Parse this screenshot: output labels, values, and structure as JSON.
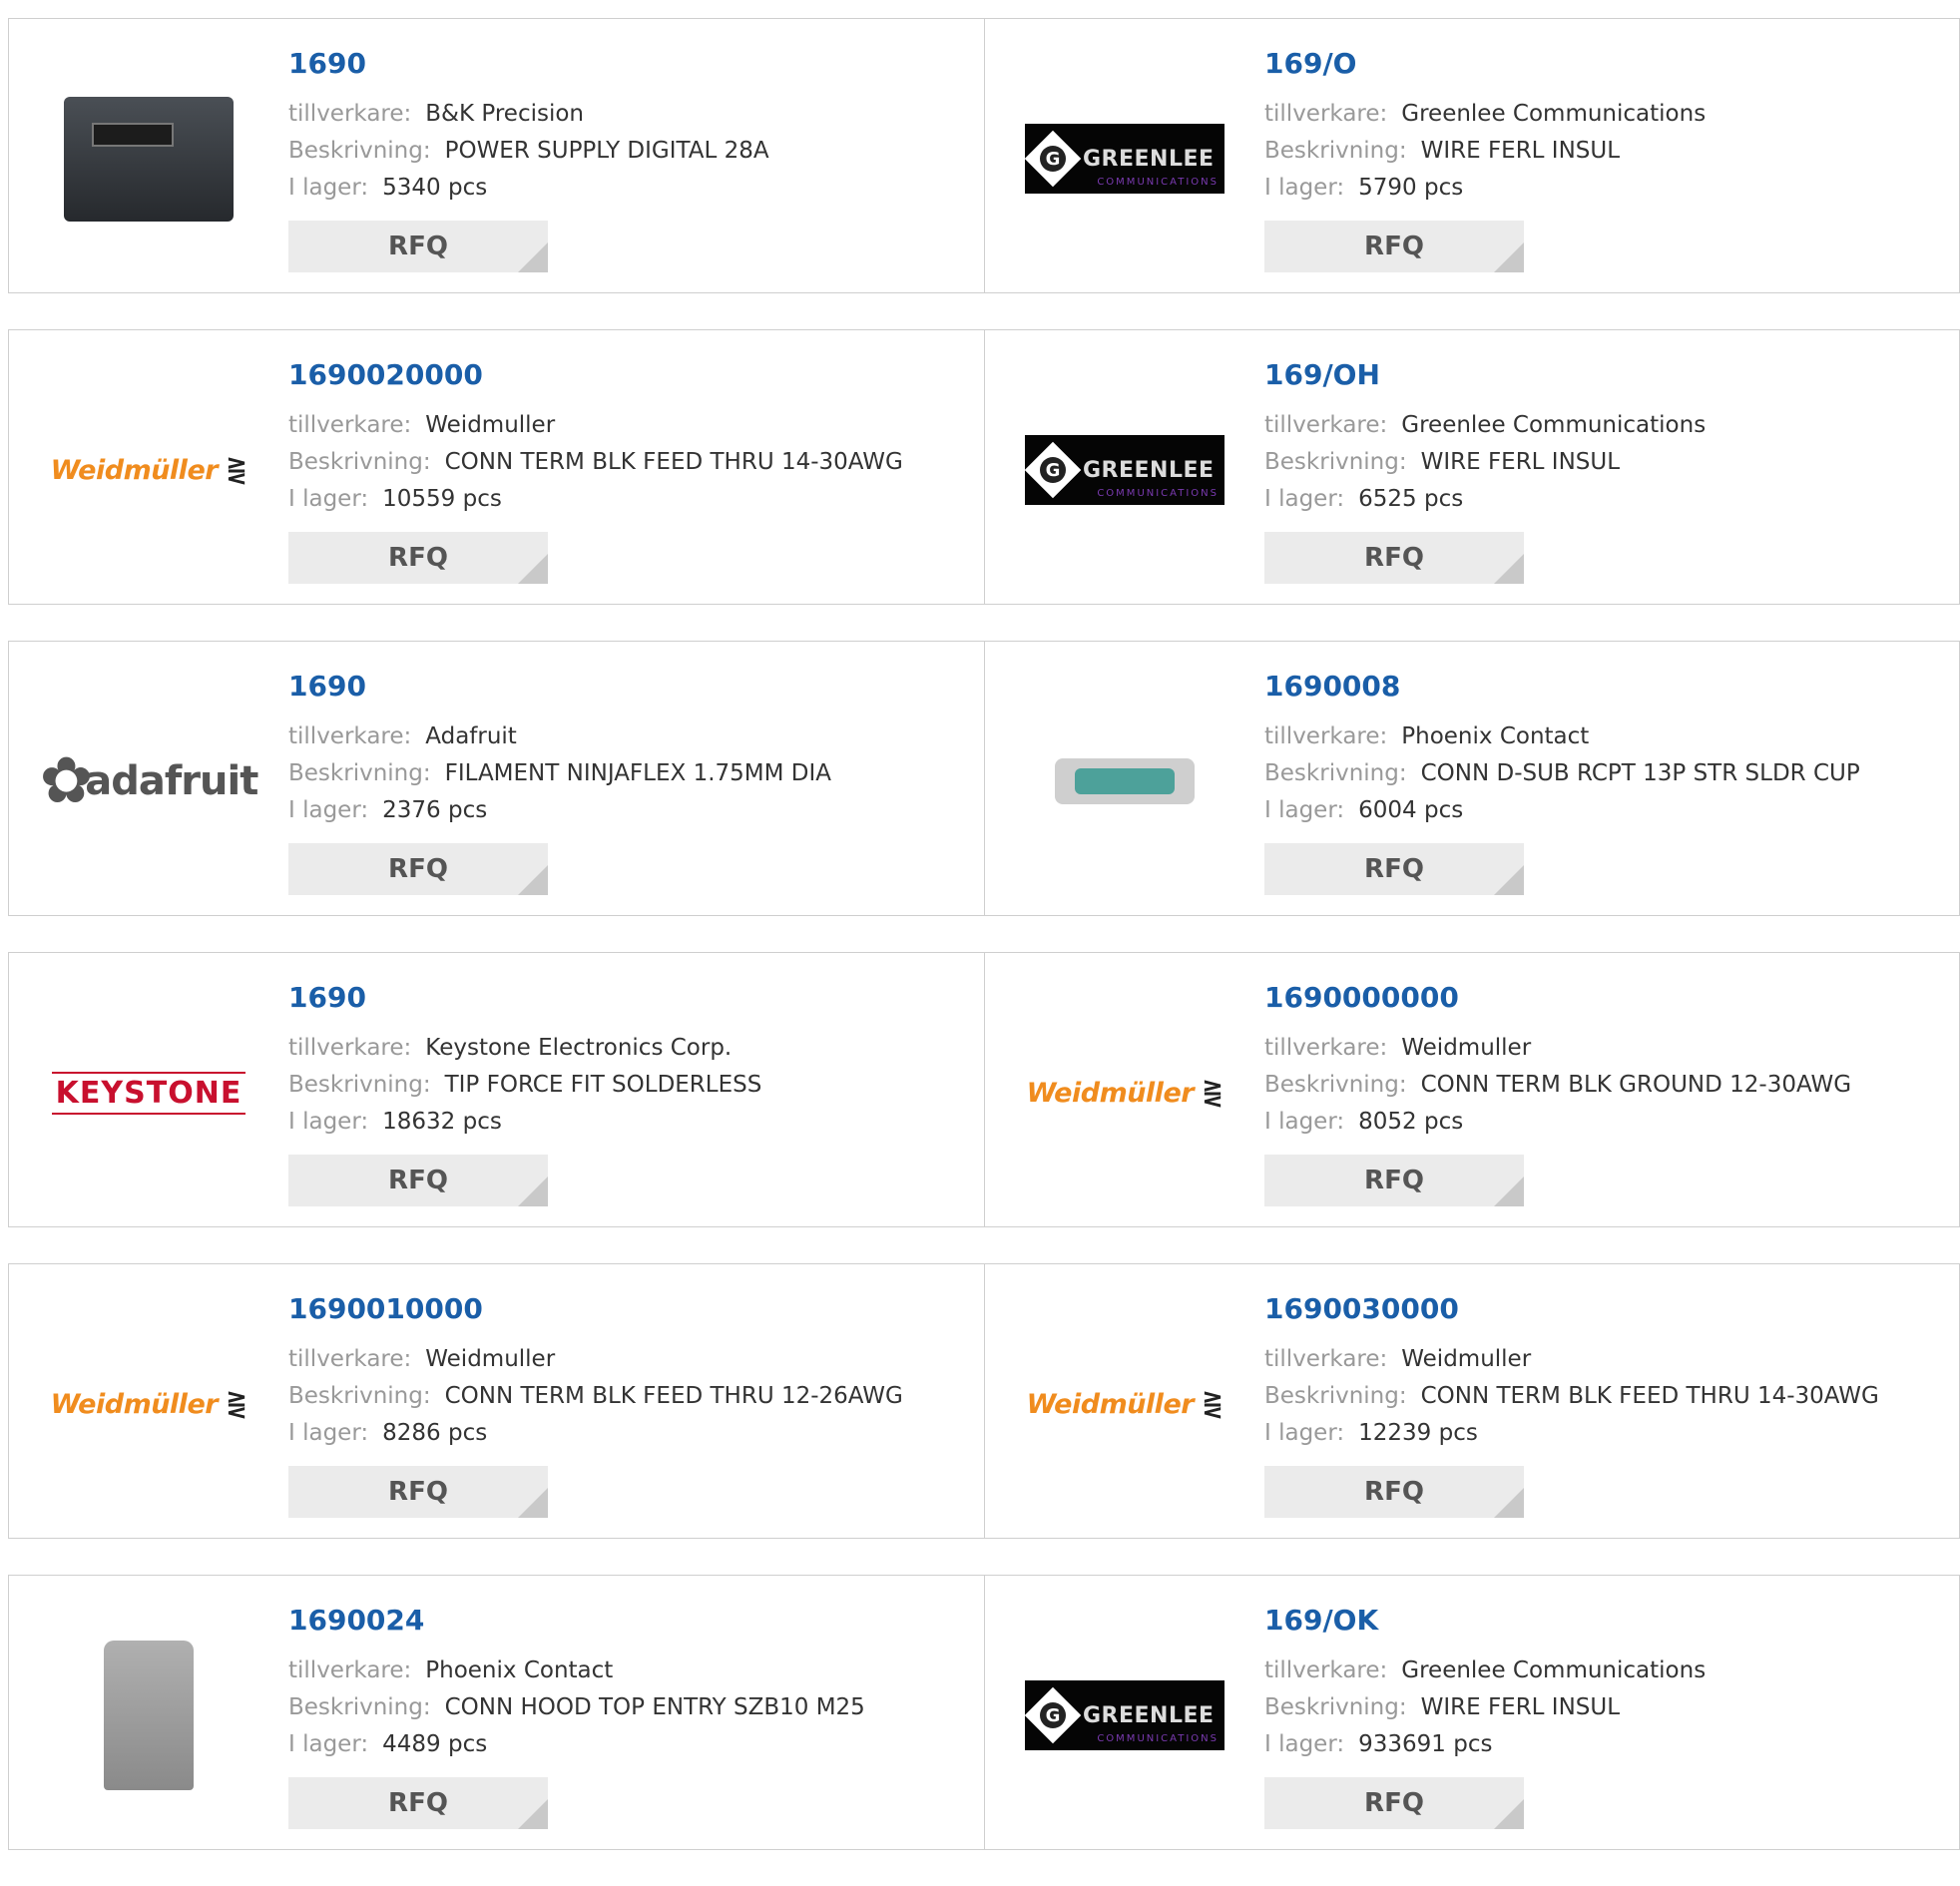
{
  "labels": {
    "manufacturer": "tillverkare:",
    "description": "Beskrivning:",
    "stock": "I lager:",
    "rfq": "RFQ"
  },
  "rows": [
    [
      {
        "part": "1690",
        "manufacturer": "B&K Precision",
        "description": "POWER SUPPLY DIGITAL 28A",
        "stock": "5340 pcs",
        "image": "power-supply-photo"
      },
      {
        "part": "169/O",
        "manufacturer": "Greenlee Communications",
        "description": "WIRE FERL INSUL",
        "stock": "5790 pcs",
        "image": "greenlee-logo"
      }
    ],
    [
      {
        "part": "1690020000",
        "manufacturer": "Weidmuller",
        "description": "CONN TERM BLK FEED THRU 14-30AWG",
        "stock": "10559 pcs",
        "image": "weidmuller-logo"
      },
      {
        "part": "169/OH",
        "manufacturer": "Greenlee Communications",
        "description": "WIRE FERL INSUL",
        "stock": "6525 pcs",
        "image": "greenlee-logo"
      }
    ],
    [
      {
        "part": "1690",
        "manufacturer": "Adafruit",
        "description": "FILAMENT NINJAFLEX 1.75MM DIA",
        "stock": "2376 pcs",
        "image": "adafruit-logo"
      },
      {
        "part": "1690008",
        "manufacturer": "Phoenix Contact",
        "description": "CONN D-SUB RCPT 13P STR SLDR CUP",
        "stock": "6004 pcs",
        "image": "dsub-connector-photo"
      }
    ],
    [
      {
        "part": "1690",
        "manufacturer": "Keystone Electronics Corp.",
        "description": "TIP FORCE FIT SOLDERLESS",
        "stock": "18632 pcs",
        "image": "keystone-logo"
      },
      {
        "part": "1690000000",
        "manufacturer": "Weidmuller",
        "description": "CONN TERM BLK GROUND 12-30AWG",
        "stock": "8052 pcs",
        "image": "weidmuller-logo"
      }
    ],
    [
      {
        "part": "1690010000",
        "manufacturer": "Weidmuller",
        "description": "CONN TERM BLK FEED THRU 12-26AWG",
        "stock": "8286 pcs",
        "image": "weidmuller-logo"
      },
      {
        "part": "1690030000",
        "manufacturer": "Weidmuller",
        "description": "CONN TERM BLK FEED THRU 14-30AWG",
        "stock": "12239 pcs",
        "image": "weidmuller-logo"
      }
    ],
    [
      {
        "part": "1690024",
        "manufacturer": "Phoenix Contact",
        "description": "CONN HOOD TOP ENTRY SZB10 M25",
        "stock": "4489 pcs",
        "image": "connector-hood-photo"
      },
      {
        "part": "169/OK",
        "manufacturer": "Greenlee Communications",
        "description": "WIRE FERL INSUL",
        "stock": "933691 pcs",
        "image": "greenlee-logo"
      }
    ]
  ],
  "logos": {
    "weidmuller": "Weidmüller",
    "weidmuller_symbol": "⋛",
    "greenlee": "GREENLEE",
    "greenlee_sub": "COMMUNICATIONS",
    "greenlee_g": "G",
    "adafruit": "adafruit",
    "keystone": "KEYSTONE"
  },
  "colors": {
    "part_link": "#1a5ea8",
    "label": "#999999",
    "value": "#333333",
    "rfq_bg": "#ebebeb",
    "weidmuller_orange": "#f08c1e",
    "keystone_red": "#c8102e"
  }
}
